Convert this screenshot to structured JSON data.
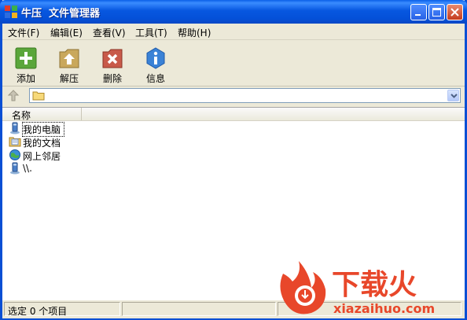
{
  "window": {
    "title": "牛压  文件管理器"
  },
  "menu": {
    "items": [
      {
        "label": "文件(F)"
      },
      {
        "label": "编辑(E)"
      },
      {
        "label": "查看(V)"
      },
      {
        "label": "工具(T)"
      },
      {
        "label": "帮助(H)"
      }
    ]
  },
  "toolbar": {
    "buttons": [
      {
        "label": "添加",
        "icon": "add-icon",
        "color": "#5aa63a"
      },
      {
        "label": "解压",
        "icon": "extract-icon",
        "color": "#c9a85c"
      },
      {
        "label": "删除",
        "icon": "delete-icon",
        "color": "#c85a4a"
      },
      {
        "label": "信息",
        "icon": "info-icon",
        "color": "#3a82d6"
      }
    ]
  },
  "address": {
    "value": ""
  },
  "list": {
    "column_name": "名称",
    "rows": [
      {
        "label": "我的电脑",
        "icon": "computer-icon"
      },
      {
        "label": "我的文档",
        "icon": "documents-folder-icon"
      },
      {
        "label": "网上邻居",
        "icon": "network-icon"
      },
      {
        "label": "\\\\.",
        "icon": "computer-icon"
      }
    ]
  },
  "status": {
    "text": "选定 0 个项目"
  },
  "watermark": {
    "text_cn": "下载火",
    "text_url": "xiazaihuo.com",
    "color": "#e8472a"
  },
  "colors": {
    "titlebar": "#0757e0",
    "chrome": "#ece9d8"
  }
}
